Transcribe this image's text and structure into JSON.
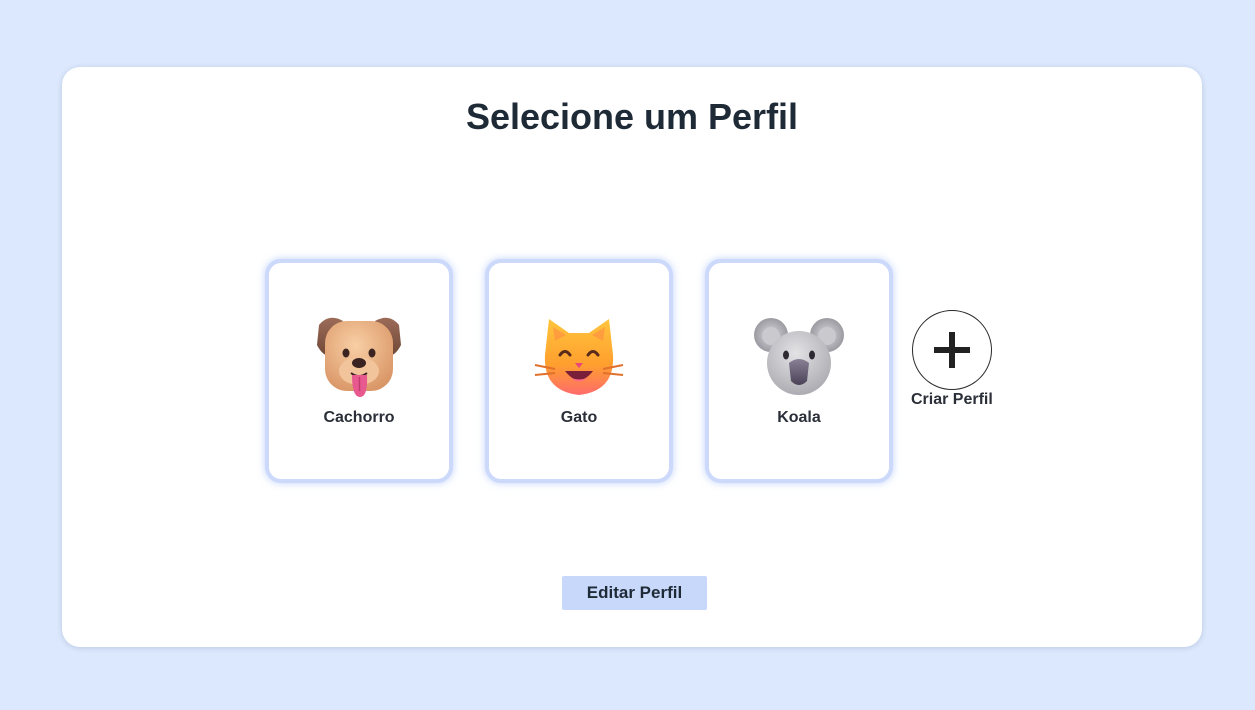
{
  "page": {
    "title": "Selecione um Perfil"
  },
  "profiles": [
    {
      "name": "Cachorro",
      "icon": "dog-face-icon"
    },
    {
      "name": "Gato",
      "icon": "cat-face-icon"
    },
    {
      "name": "Koala",
      "icon": "koala-face-icon"
    }
  ],
  "create_profile": {
    "label": "Criar Perfil",
    "icon": "plus-icon"
  },
  "actions": {
    "edit_label": "Editar Perfil"
  },
  "colors": {
    "background": "#dce8fd",
    "card": "#ffffff",
    "profile_border": "#ccd9fb",
    "button": "#c7d8fb",
    "text": "#1f2a37"
  }
}
